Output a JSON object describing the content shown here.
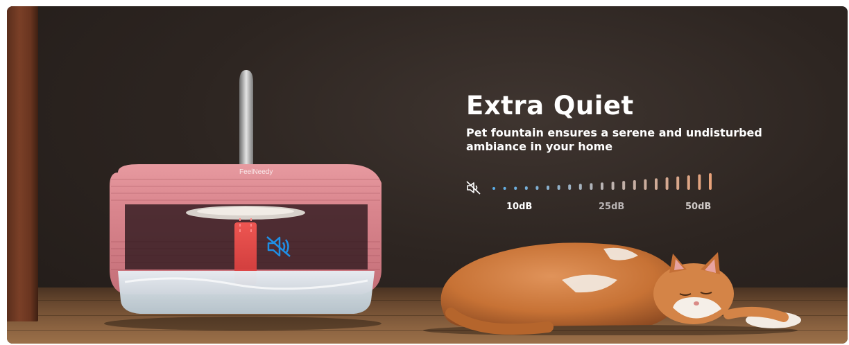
{
  "brand": "FeelNeedy",
  "headline": "Extra Quiet",
  "subheadline": "Pet fountain ensures a serene and undisturbed ambiance in your home",
  "noise_scale": {
    "labels": [
      "10dB",
      "25dB",
      "50dB"
    ],
    "colors": {
      "quiet": "#5aaee8",
      "mid": "#b9b4b4",
      "loud": "#e7a27a",
      "mute_icon": "#ffffff",
      "fountain_mute_icon": "#1f8fe6"
    }
  }
}
